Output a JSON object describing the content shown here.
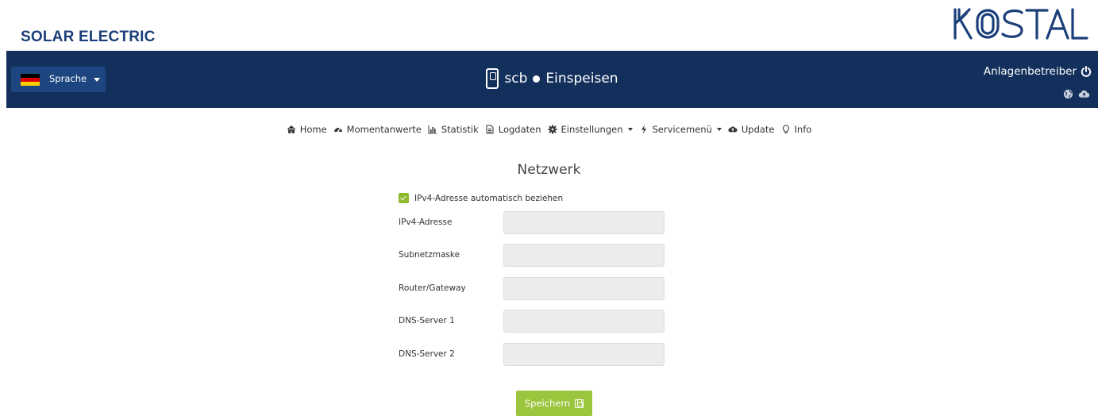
{
  "brand": {
    "title": "SOLAR ELECTRIC",
    "logo_text": "KOSTAL",
    "logo_color": "#1b3f7a"
  },
  "header": {
    "background": "#132f5c",
    "language_button": "Sprache",
    "flag": "germany-flag",
    "device_icon": "inverter-icon",
    "device_name": "scb",
    "status": "Einspeisen",
    "operator_label": "Anlagenbetreiber",
    "operator_icon": "power-icon",
    "status_icons": [
      "globe-icon",
      "cloud-upload-icon"
    ]
  },
  "nav": {
    "items": [
      {
        "label": "Home",
        "icon": "home-icon",
        "dropdown": false
      },
      {
        "label": "Momentanwerte",
        "icon": "dashboard-icon",
        "dropdown": false
      },
      {
        "label": "Statistik",
        "icon": "bar-chart-icon",
        "dropdown": false
      },
      {
        "label": "Logdaten",
        "icon": "document-icon",
        "dropdown": false
      },
      {
        "label": "Einstellungen",
        "icon": "gear-icon",
        "dropdown": true
      },
      {
        "label": "Servicemenü",
        "icon": "lightning-icon",
        "dropdown": true
      },
      {
        "label": "Update",
        "icon": "cloud-upload-icon",
        "dropdown": false
      },
      {
        "label": "Info",
        "icon": "lightbulb-icon",
        "dropdown": false
      }
    ]
  },
  "form": {
    "title": "Netzwerk",
    "auto_ip": {
      "label": "IPv4-Adresse automatisch beziehen",
      "checked": true
    },
    "fields": [
      {
        "label": "IPv4-Adresse",
        "value": ""
      },
      {
        "label": "Subnetzmaske",
        "value": ""
      },
      {
        "label": "Router/Gateway",
        "value": ""
      },
      {
        "label": "DNS-Server 1",
        "value": ""
      },
      {
        "label": "DNS-Server 2",
        "value": ""
      }
    ],
    "save_label": "Speichern",
    "save_color": "#9bc53d",
    "checkbox_color": "#8dba2e"
  }
}
